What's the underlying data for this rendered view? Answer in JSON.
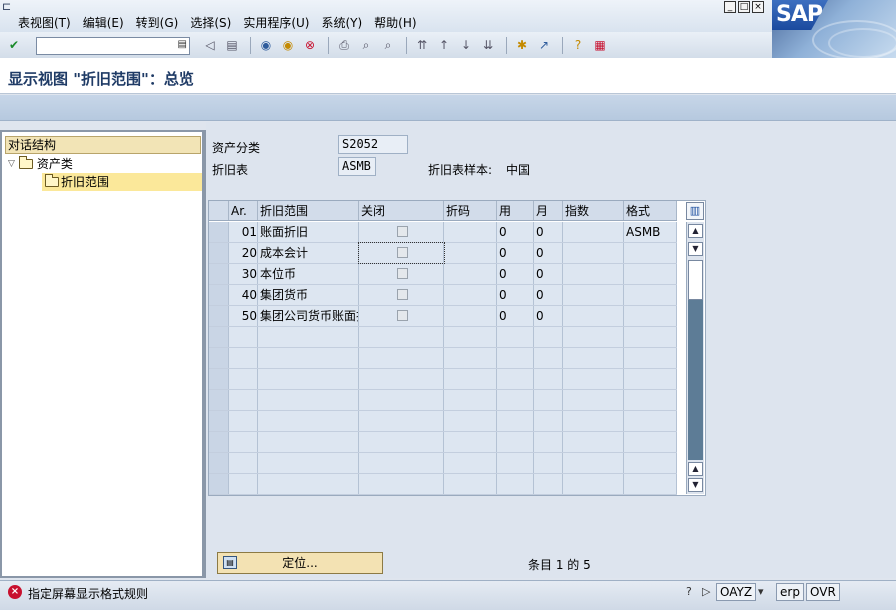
{
  "menu": {
    "items": [
      "表视图(T)",
      "编辑(E)",
      "转到(G)",
      "选择(S)",
      "实用程序(U)",
      "系统(Y)",
      "帮助(H)"
    ]
  },
  "logo": {
    "text": "SAP"
  },
  "toolbar": {
    "icons": [
      "enter-icon",
      "save-icon",
      "back-icon",
      "exit-icon",
      "cancel-icon",
      "print-icon",
      "find-icon",
      "find-next-icon",
      "first-page-icon",
      "prev-page-icon",
      "next-page-icon",
      "last-page-icon",
      "create-session-icon",
      "shortcut-icon",
      "help-icon",
      "layout-icon"
    ]
  },
  "title": "显示视图 \"折旧范围\"：总览",
  "tree": {
    "header": "对话结构",
    "node_parent": "资产类",
    "node_child": "折旧范围"
  },
  "form": {
    "asset_class_label": "资产分类",
    "asset_class_value": "S2052",
    "dep_key_label": "折旧表",
    "dep_key_value": "ASMB",
    "dep_sample_label": "折旧表样本:",
    "dep_sample_value": "中国"
  },
  "table": {
    "columns": [
      "Ar.",
      "折旧范围",
      "关闭",
      "折码",
      "用",
      "月",
      "指数",
      "格式"
    ],
    "rows": [
      {
        "ar": "01",
        "name": "账面折旧",
        "use": "0",
        "month": "0",
        "fmt": "ASMB"
      },
      {
        "ar": "20",
        "name": "成本会计",
        "use": "0",
        "month": "0",
        "fmt": ""
      },
      {
        "ar": "30",
        "name": "本位币",
        "use": "0",
        "month": "0",
        "fmt": ""
      },
      {
        "ar": "40",
        "name": "集团货币",
        "use": "0",
        "month": "0",
        "fmt": ""
      },
      {
        "ar": "50",
        "name": "集团公司货币账面折",
        "use": "0",
        "month": "0",
        "fmt": ""
      }
    ]
  },
  "position_button": "定位...",
  "entry_count": "条目 1 的 5",
  "status": {
    "message": "指定屏幕显示格式规则",
    "system": "OAYZ",
    "client": "erp",
    "mode": "OVR"
  },
  "colors": {
    "title": "#1f3b66",
    "tree_header": "#f2e4b6",
    "tree_selected": "#fbe89a",
    "button": "#f3e2b3",
    "error": "#c8102e"
  }
}
